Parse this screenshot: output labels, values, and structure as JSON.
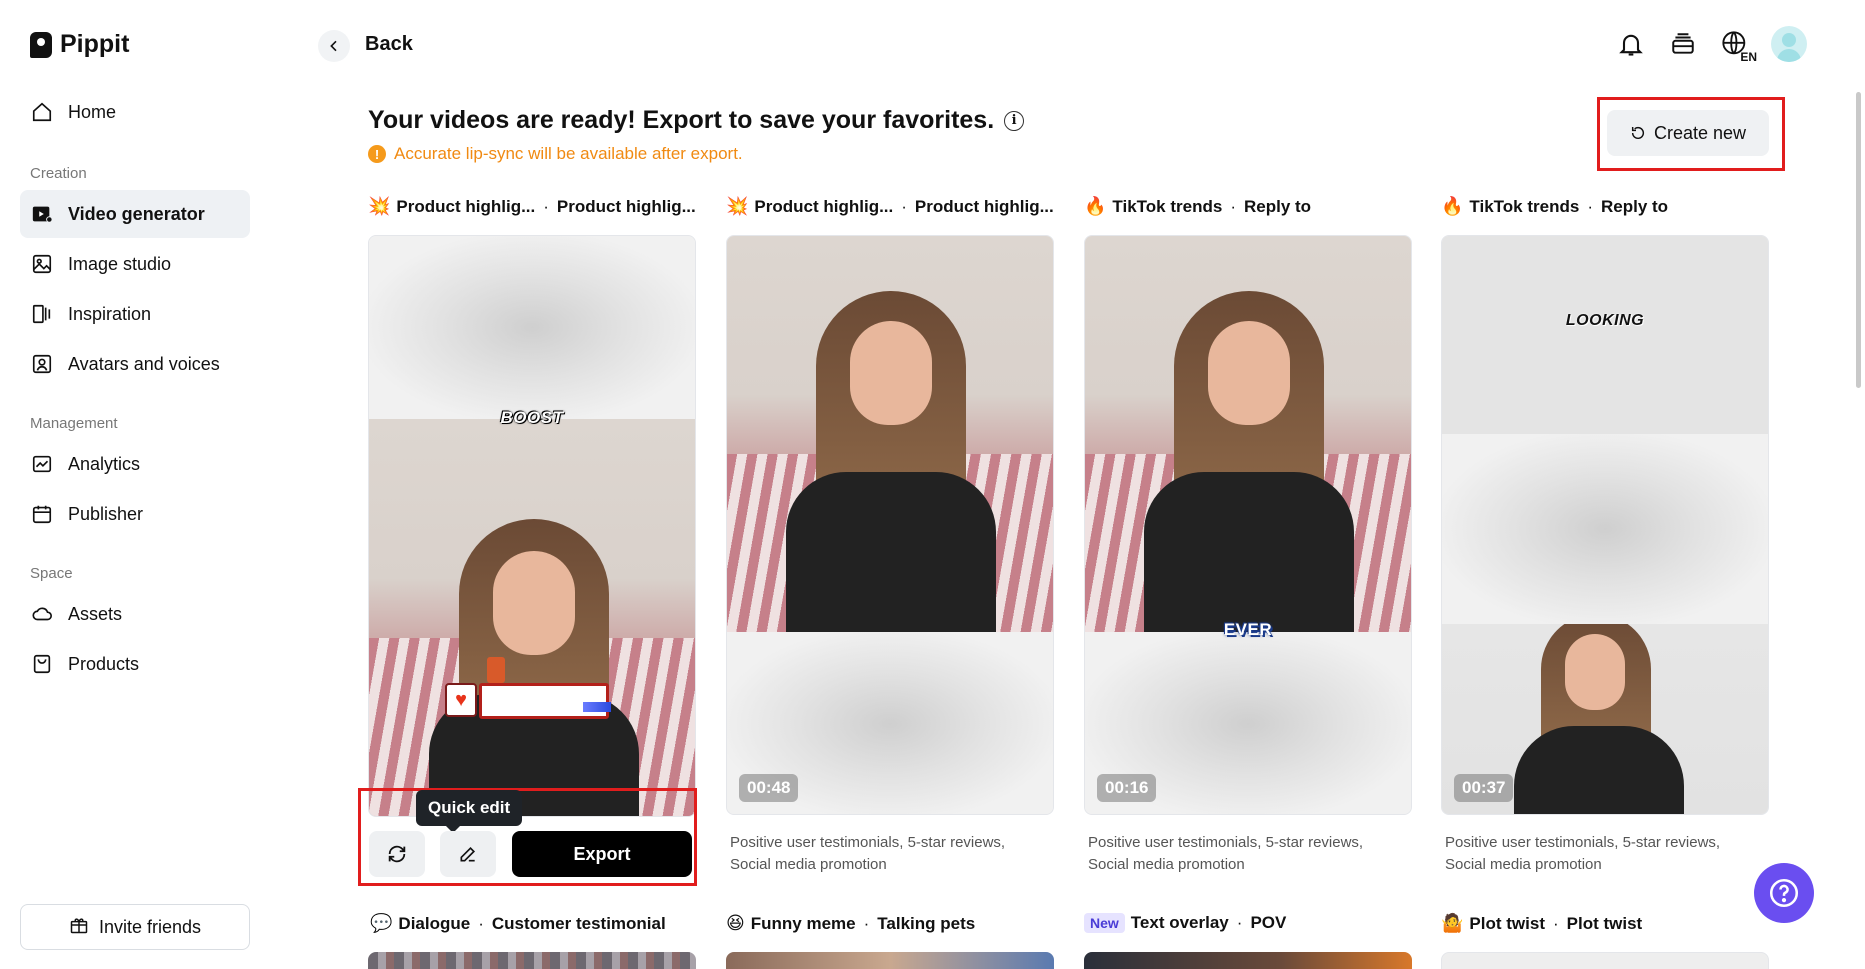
{
  "app": {
    "name": "Pippit"
  },
  "sidebar": {
    "items": [
      {
        "label": "Home",
        "icon": "home-icon"
      },
      {
        "label": "Video generator",
        "icon": "video-icon"
      },
      {
        "label": "Image studio",
        "icon": "image-icon"
      },
      {
        "label": "Inspiration",
        "icon": "inspiration-icon"
      },
      {
        "label": "Avatars and voices",
        "icon": "avatar-icon"
      },
      {
        "label": "Analytics",
        "icon": "analytics-icon"
      },
      {
        "label": "Publisher",
        "icon": "calendar-icon"
      },
      {
        "label": "Assets",
        "icon": "cloud-icon"
      },
      {
        "label": "Products",
        "icon": "product-icon"
      }
    ],
    "sections": {
      "creation": "Creation",
      "management": "Management",
      "space": "Space"
    },
    "invite_label": "Invite friends"
  },
  "header": {
    "back_label": "Back",
    "lang": "EN"
  },
  "main": {
    "headline": "Your videos are ready! Export to save your favorites.",
    "notice": "Accurate lip-sync will be available after export.",
    "create_new_label": "Create new",
    "cards": [
      {
        "emoji": "💥",
        "category": "Product highlig...",
        "subtitle": "Product highlig...",
        "caption": "BOOST",
        "duration": "",
        "desc": ""
      },
      {
        "emoji": "💥",
        "category": "Product highlig...",
        "subtitle": "Product highlig...",
        "caption": "",
        "duration": "00:48",
        "desc": "Positive user testimonials, 5-star reviews, Social media promotion"
      },
      {
        "emoji": "🔥",
        "category": "TikTok trends",
        "subtitle": "Reply to",
        "caption": "EVER",
        "duration": "00:16",
        "desc": "Positive user testimonials, 5-star reviews, Social media promotion"
      },
      {
        "emoji": "🔥",
        "category": "TikTok trends",
        "subtitle": "Reply to",
        "caption": "LOOKING",
        "duration": "00:37",
        "desc": "Positive user testimonials, 5-star reviews, Social media promotion"
      }
    ],
    "row2": [
      {
        "emoji": "💬",
        "category": "Dialogue",
        "subtitle": "Customer testimonial"
      },
      {
        "emoji": "😆",
        "category": "Funny meme",
        "subtitle": "Talking pets"
      },
      {
        "badge": "New",
        "category": "Text overlay",
        "subtitle": "POV"
      },
      {
        "emoji": "🤷",
        "category": "Plot twist",
        "subtitle": "Plot twist"
      }
    ],
    "quick_edit_tooltip": "Quick edit",
    "export_label": "Export"
  },
  "colors": {
    "accent": "#6a4ef0",
    "highlight": "#e11d1d",
    "warning": "#f08a12"
  }
}
